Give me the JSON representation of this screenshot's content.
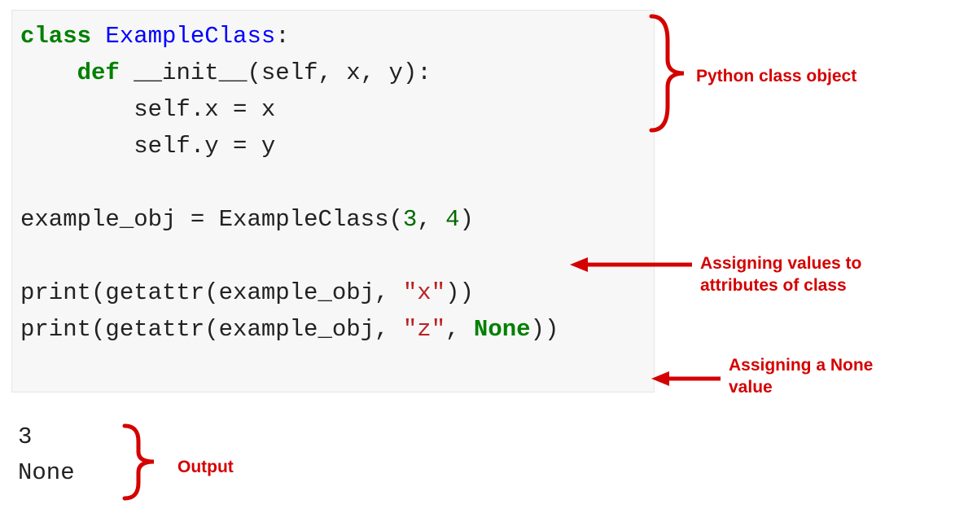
{
  "code": {
    "kw_class": "class",
    "cls_name": "ExampleClass",
    "colon": ":",
    "kw_def": "def",
    "init_name": "__init__",
    "init_params": "(self, x, y):",
    "line3": "        self.x = x",
    "line4": "        self.y = y",
    "inst_var": "example_obj",
    "equals": " = ",
    "inst_call_pre": "ExampleClass(",
    "inst_arg1": "3",
    "inst_comma": ", ",
    "inst_arg2": "4",
    "inst_call_post": ")",
    "print1_pre": "print(getattr(example_obj, ",
    "print1_str": "\"x\"",
    "print1_post": "))",
    "print2_pre": "print(getattr(example_obj, ",
    "print2_str": "\"z\"",
    "print2_comma": ", ",
    "none_kw": "None",
    "print2_post": "))"
  },
  "output": {
    "line1": "3",
    "line2": "None"
  },
  "annotations": {
    "class_object": "Python class object",
    "assigning_values": "Assigning values to attributes of class",
    "assigning_none": "Assigning a None value",
    "output_label": "Output"
  },
  "colors": {
    "accent": "#d50000",
    "keyword": "#008000",
    "classname": "#0000ff",
    "string": "#ba2121",
    "bg": "#f7f7f7"
  }
}
